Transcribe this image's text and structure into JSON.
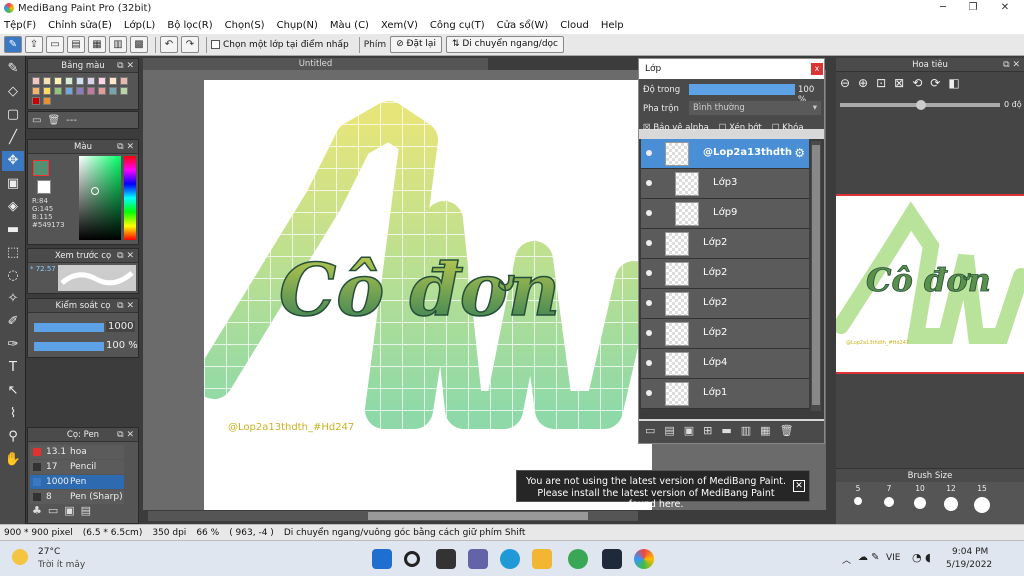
{
  "app": {
    "title": "MediBang Paint Pro (32bit)"
  },
  "menu": [
    "Tệp(F)",
    "Chỉnh sửa(E)",
    "Lớp(L)",
    "Bộ lọc(R)",
    "Chọn(S)",
    "Chụp(N)",
    "Màu (C)",
    "Xem(V)",
    "Công cụ(T)",
    "Cửa sổ(W)",
    "Cloud",
    "Help"
  ],
  "toolbar": {
    "check_label": "Chọn một lớp tại điểm nhấp",
    "phim": "Phím",
    "reset": "Đặt lại",
    "move": "Di chuyển ngang/dọc"
  },
  "panels": {
    "swatches": "Bảng màu",
    "color": "Màu",
    "color_values": {
      "r": "R:84",
      "g": "G:145",
      "b": "B:115",
      "hex": "#549173"
    },
    "preview": "Xem trước cọ",
    "preview_value": "* 72.57",
    "brush_ctrl": "Kiểm soát cọ",
    "brush_size": "1000",
    "brush_opacity": "100 %",
    "brush_title": "Cọ: Pen",
    "brushes": [
      {
        "size": "13.1",
        "name": "hoa",
        "color": "#e53030"
      },
      {
        "size": "17",
        "name": "Pencil",
        "color": "#333333"
      },
      {
        "size": "1000",
        "name": "Pen",
        "color": "#3a78c4"
      },
      {
        "size": "8",
        "name": "Pen (Sharp)",
        "color": "#333333"
      }
    ],
    "swatch_more": "---"
  },
  "canvas": {
    "tab": "Untitled",
    "watermark": "@Lop2a13thdth_#Hd247",
    "text_main": "Cô đơn"
  },
  "layers": {
    "title": "Lớp",
    "opacity_label": "Độ trong",
    "opacity_value": "100 %",
    "blend_label": "Pha trộn",
    "blend_value": "Bình thường",
    "protect_alpha": "Bảo vệ alpha",
    "clip": "Xén bớt",
    "lock": "Khóa",
    "rows": [
      {
        "name": "@Lop2a13thdth",
        "sel": true
      },
      {
        "name": "Lớp3",
        "sel": false
      },
      {
        "name": "Lớp9",
        "sel": false
      },
      {
        "name": "Lớp2",
        "sel": false
      },
      {
        "name": "Lớp2",
        "sel": false
      },
      {
        "name": "Lớp2",
        "sel": false
      },
      {
        "name": "Lớp2",
        "sel": false
      },
      {
        "name": "Lớp4",
        "sel": false
      },
      {
        "name": "Lớp1",
        "sel": false
      }
    ]
  },
  "navigator": {
    "title": "Hoa tiêu",
    "zoom": "0 độ",
    "preview_text": "Cô đơn",
    "preview_watermark": "@Lop2a13thdth_#Hd247"
  },
  "brush_size_panel": {
    "title": "Brush Size",
    "sizes": [
      "5",
      "7",
      "10",
      "12",
      "15"
    ]
  },
  "notice": {
    "line1": "You are not using the latest version of MediBang Paint.",
    "line2": "Please install the latest version of MediBang Paint found here."
  },
  "status": {
    "size": "900 * 900 pixel",
    "cm": "(6.5 * 6.5cm)",
    "dpi": "350 dpi",
    "zoom": "66 %",
    "coord": "( 963, -4 )",
    "hint": "Di chuyển ngang/vuông góc bằng cách giữ phím Shift"
  },
  "taskbar": {
    "temp": "27°C",
    "weather": "Trời ít mây",
    "lang": "VIE",
    "time": "9:04 PM",
    "date": "5/19/2022"
  }
}
